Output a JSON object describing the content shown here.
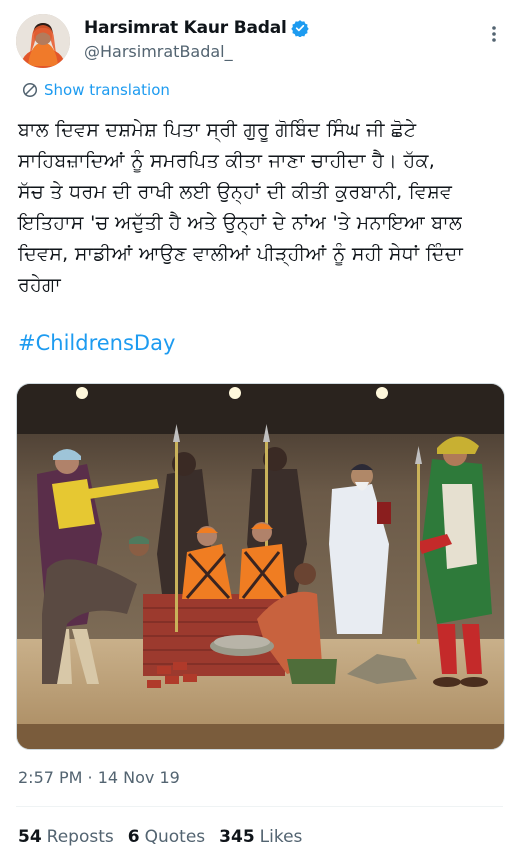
{
  "tweet": {
    "display_name": "Harsimrat Kaur Badal",
    "handle": "@HarsimratBadal_",
    "verified": true,
    "show_translation": "Show translation",
    "body": "ਬਾਲ ਦਿਵਸ ਦਸ਼ਮੇਸ਼ ਪਿਤਾ ਸ੍ਰੀ ਗੁਰੂ ਗੋਬਿੰਦ ਸਿੰਘ ਜੀ ਛੋਟੇ\nਸਾਹਿਬਜ਼ਾਦਿਆਂ ਨੂੰ ਸਮਰਪਿਤ ਕੀਤਾ ਜਾਣਾ ਚਾਹੀਦਾ ਹੈ। ਹੱਕ,\nਸੱਚ ਤੇ ਧਰਮ ਦੀ ਰਾਖੀ ਲਈ ਉਨ੍ਹਾਂ ਦੀ ਕੀਤੀ ਕੁਰਬਾਨੀ, ਵਿਸ਼ਵ\nਇਤਿਹਾਸ 'ਚ ਅਦੁੱਤੀ ਹੈ ਅਤੇ ਉਨ੍ਹਾਂ ਦੇ ਨਾਂਅ 'ਤੇ ਮਨਾਇਆ ਬਾਲ\nਦਿਵਸ, ਸਾਡੀਆਂ ਆਉਣ ਵਾਲੀਆਂ ਪੀੜ੍ਹੀਆਂ ਨੂੰ ਸਹੀ ਸੇਧਾਂ ਦਿੰਦਾ\nਰਹੇਗਾ",
    "hashtag": "#ChildrensDay",
    "timestamp": "2:57 PM · 14 Nov 19",
    "stats": {
      "reposts_count": "54",
      "reposts_label": "Reposts",
      "quotes_count": "6",
      "quotes_label": "Quotes",
      "likes_count": "345",
      "likes_label": "Likes"
    }
  },
  "icons": {
    "verified": "verified-badge-icon",
    "more": "more-options-icon",
    "translate": "globe-icon"
  },
  "colors": {
    "accent": "#1d9bf0",
    "text": "#0f1419",
    "secondary": "#536471",
    "border": "#eff3f4"
  }
}
